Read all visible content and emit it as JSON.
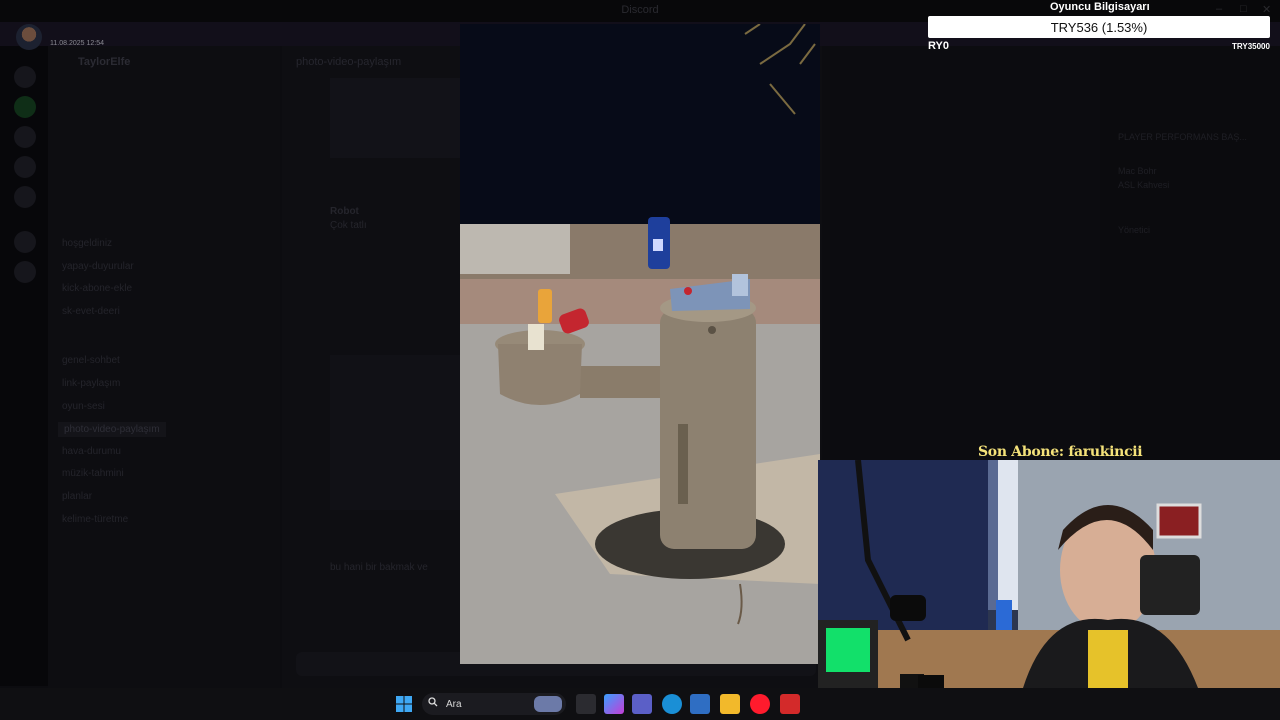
{
  "window": {
    "title": "Discord",
    "controls": [
      "–",
      "□",
      "✕"
    ]
  },
  "overlay": {
    "timestamp": "11.08.2025 12:54",
    "player_label": "Oyuncu Bilgisayarı",
    "player_value": "TRY536 (1.53%)",
    "left_tag": "RY0",
    "right_tag": "TRY35000",
    "last_sub": "Son Abone: farukincii"
  },
  "discord": {
    "server_name": "TaylorElfe",
    "channels": [
      "hoşgeldiniz",
      "yapay-duyurular",
      "kick-abone-ekle",
      "sk-evet-deeri",
      "genel-sohbet",
      "link-paylaşım",
      "oyun-sesi",
      "photo-video-paylaşım",
      "hava-durumu",
      "müzik-tahmini",
      "planlar",
      "kelime-türetme"
    ],
    "active_channel": "photo-video-paylaşım",
    "chat_header": "photo-video-paylaşım",
    "messages": [
      {
        "author": "Robot",
        "text": "Çok tatlı"
      },
      {
        "author": "",
        "text": "bu hani bir bakmak ve"
      }
    ],
    "members": [
      "PLAYER PERFORMANS BAŞ...",
      "Mac Bohr",
      "ASL Kahvesi",
      "Yönetici"
    ]
  },
  "taskbar": {
    "search_placeholder": "Ara",
    "icons": [
      "windows-start-icon",
      "search-icon",
      "task-view-icon",
      "copilot-icon",
      "teams-icon",
      "edge-icon",
      "store-icon",
      "file-explorer-icon",
      "opera-icon",
      "app-w-icon"
    ]
  },
  "colors": {
    "subtitle": "#f4e27a",
    "accent": "#5865f2"
  }
}
